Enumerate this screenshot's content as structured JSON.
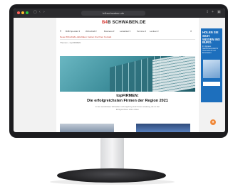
{
  "browser": {
    "url": "b4bschwaben.de"
  },
  "site": {
    "logo_prefix": "B",
    "logo_mid": "4",
    "logo_suffix": "B SCHWABEN.DE",
    "nav": [
      "B4B Specials ▾",
      "Wirtschaft ▾",
      "Business ▾",
      "Leitartikel ▾",
      "Termine ▾",
      "Lexikon ▾"
    ],
    "alert": "Neue Wirtschafts-Aktivitäten: Geben Sie Ihren Kontakt",
    "breadcrumb": "Themen › topFIRMEN",
    "article": {
      "title_line1": "topFIRMEN:",
      "title_line2": "Die erfolgreichsten Firmen der Region 2021",
      "teaser_line1": "In den Landkreisen Schwaben und Augsburg sind Firmen ansässig, die zu den",
      "teaser_line2": "Erfolgreichsten 2021 zählen"
    }
  },
  "ad": {
    "headline": "HOLEN SIE SICH WISSEN INS BÜRO.",
    "sub": "Ihr digitales Nachrichtenportal für Unternehmer und Entscheider"
  },
  "colors": {
    "accent_red": "#d4312c",
    "ad_blue": "#1d6fbd",
    "fab_orange": "#f08a3c"
  }
}
